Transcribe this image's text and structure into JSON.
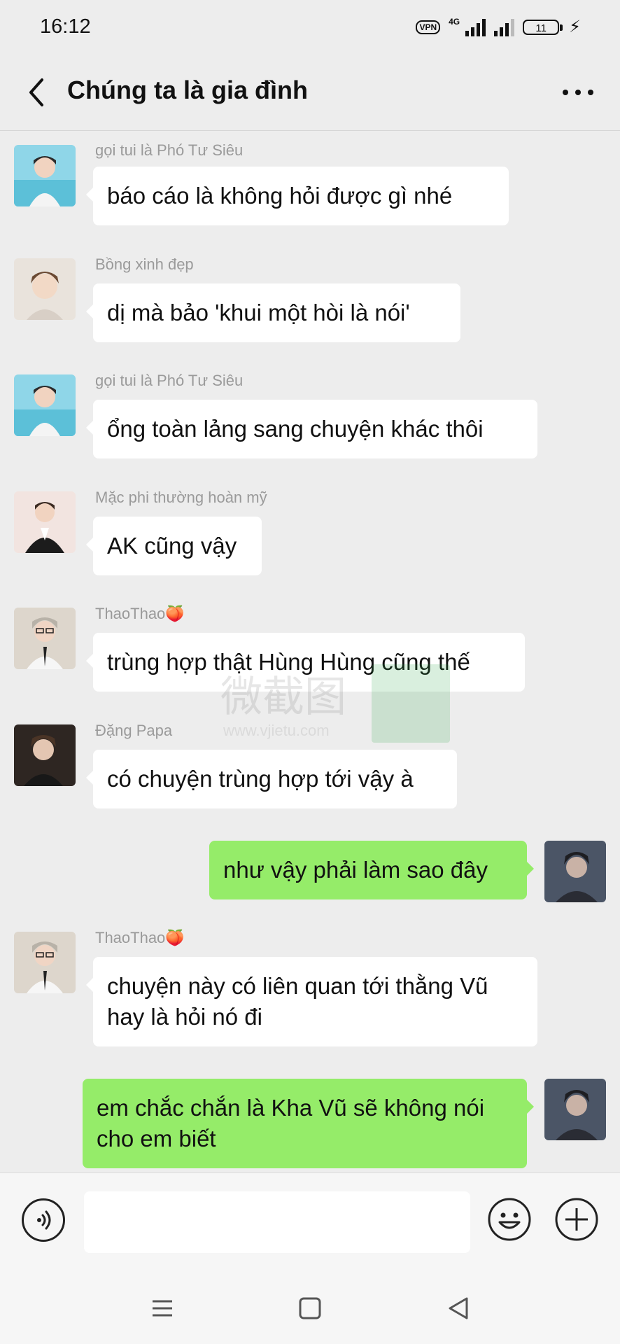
{
  "status_bar": {
    "time": "16:12",
    "vpn": "VPN",
    "network": "4G",
    "battery": "11"
  },
  "header": {
    "title": "Chúng ta là gia đình",
    "back_icon": "chevron-left-icon",
    "more_icon": "more-dots-icon"
  },
  "watermark": {
    "text": "微截图",
    "url": "www.vjietu.com"
  },
  "messages": [
    {
      "side": "in",
      "sender": "gọi tui là Phó Tư Siêu",
      "text": "báo cáo là không hỏi được gì nhé"
    },
    {
      "side": "in",
      "sender": "Bồng xinh đẹp",
      "text": "dị mà bảo 'khui một hòi là nói'"
    },
    {
      "side": "in",
      "sender": "gọi tui là Phó Tư Siêu",
      "text": "ổng toàn lảng sang chuyện khác thôi"
    },
    {
      "side": "in",
      "sender": "Mặc phi thường hoàn mỹ",
      "text": "AK cũng vậy"
    },
    {
      "side": "in",
      "sender": "ThaoThao🍑",
      "text": "trùng hợp thật Hùng Hùng cũng thế"
    },
    {
      "side": "in",
      "sender": "Đặng Papa",
      "text": "có chuyện trùng hợp tới vậy à"
    },
    {
      "side": "out",
      "sender": "",
      "text": "như vậy phải làm sao đây"
    },
    {
      "side": "in",
      "sender": "ThaoThao🍑",
      "text": "chuyện này có liên quan tới thằng Vũ hay là hỏi nó đi"
    },
    {
      "side": "out",
      "sender": "",
      "text": "em chắc chắn là Kha Vũ sẽ không nói cho em biết"
    }
  ],
  "input_bar": {
    "voice_icon": "voice-icon",
    "emoji_icon": "emoji-icon",
    "plus_icon": "plus-icon",
    "text_value": ""
  },
  "nav_bar": {
    "menu_icon": "menu-icon",
    "home_icon": "home-square-icon",
    "back_icon": "back-triangle-icon"
  },
  "colors": {
    "background": "#ededed",
    "outgoing_bubble": "#95ec69",
    "incoming_bubble": "#ffffff",
    "sender_name": "#9a9a9a"
  }
}
